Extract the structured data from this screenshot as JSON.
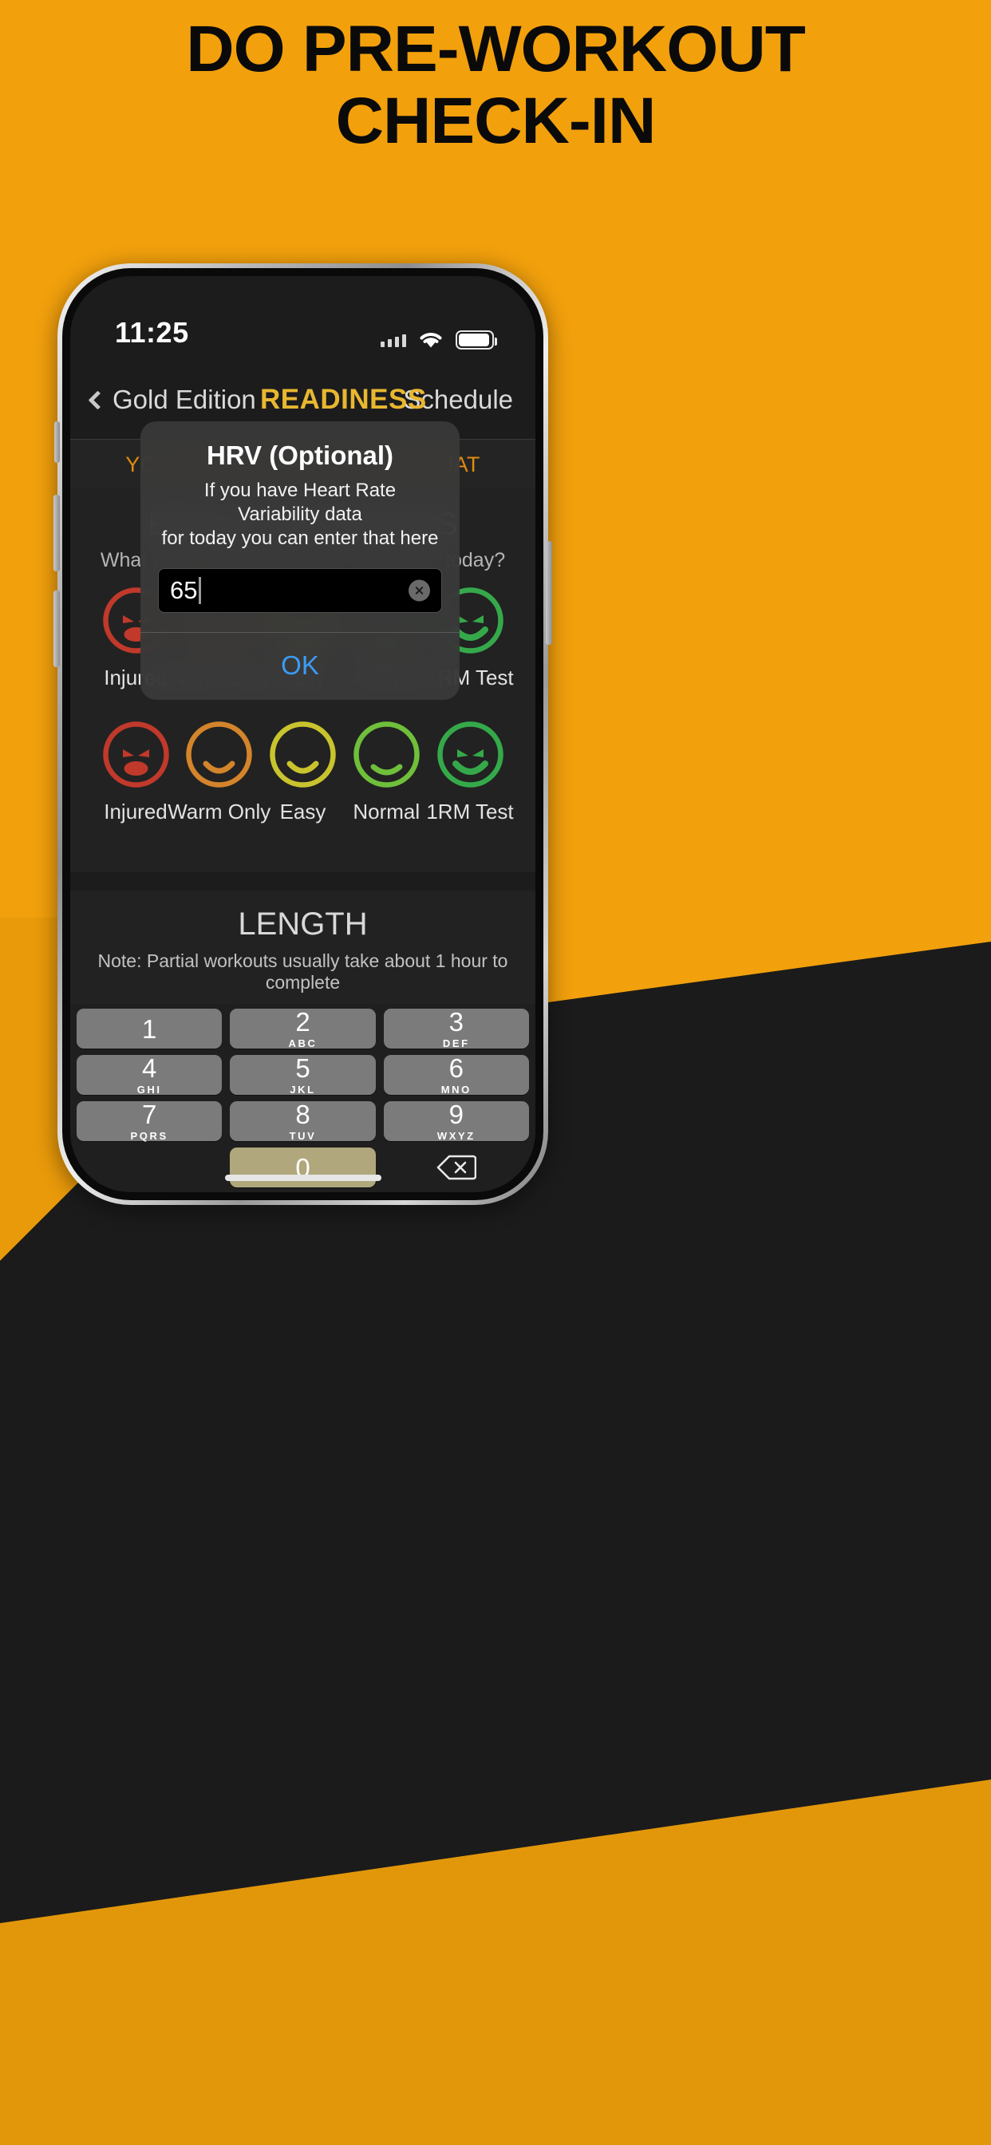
{
  "poster": {
    "headline_line1": "DO PRE-WORKOUT",
    "headline_line2": "CHECK-IN",
    "background_color": "#F2A00C",
    "text_color": "#0A0A0A"
  },
  "statusbar": {
    "time": "11:25",
    "cellular_icon": "signal-dots-icon",
    "wifi_icon": "wifi-icon",
    "battery_icon": "battery-full-icon"
  },
  "navbar": {
    "back_label": "Gold Edition",
    "back_icon": "chevron-left-icon",
    "title": "READINESS",
    "title_color": "#E8B730",
    "right_action": "Schedule"
  },
  "banner": {
    "text": "YOU ARE SCHEDULED TO SQUAT",
    "color": "#E08A10"
  },
  "readiness": {
    "title": "BENCH READINESS",
    "subtitle": "What type of training are you ready for today?",
    "options": [
      {
        "label": "Injured",
        "color": "#C0392B",
        "mood": "angry"
      },
      {
        "label": "Warm Only",
        "color": "#D4842B",
        "mood": "frown"
      },
      {
        "label": "Easy",
        "color": "#C9C42E",
        "mood": "frown"
      },
      {
        "label": "Normal",
        "color": "#6FBF3B",
        "mood": "smile"
      },
      {
        "label": "1RM Test",
        "color": "#35A94A",
        "mood": "grin"
      }
    ]
  },
  "length": {
    "title": "LENGTH",
    "note": "Note: Partial workouts usually take about 1 hour to complete"
  },
  "alert": {
    "title": "HRV (Optional)",
    "message_line1": "If you have Heart Rate Variability data",
    "message_line2": "for today you can enter that here",
    "input_value": "65",
    "clear_icon": "clear-circle-icon",
    "ok_label": "OK",
    "ok_color": "#3B9CF5"
  },
  "keyboard": {
    "keys": [
      {
        "num": "1",
        "sub": ""
      },
      {
        "num": "2",
        "sub": "ABC"
      },
      {
        "num": "3",
        "sub": "DEF"
      },
      {
        "num": "4",
        "sub": "GHI"
      },
      {
        "num": "5",
        "sub": "JKL"
      },
      {
        "num": "6",
        "sub": "MNO"
      },
      {
        "num": "7",
        "sub": "PQRS"
      },
      {
        "num": "8",
        "sub": "TUV"
      },
      {
        "num": "9",
        "sub": "WXYZ"
      },
      {
        "num": "0",
        "sub": ""
      }
    ],
    "delete_icon": "backspace-icon"
  }
}
